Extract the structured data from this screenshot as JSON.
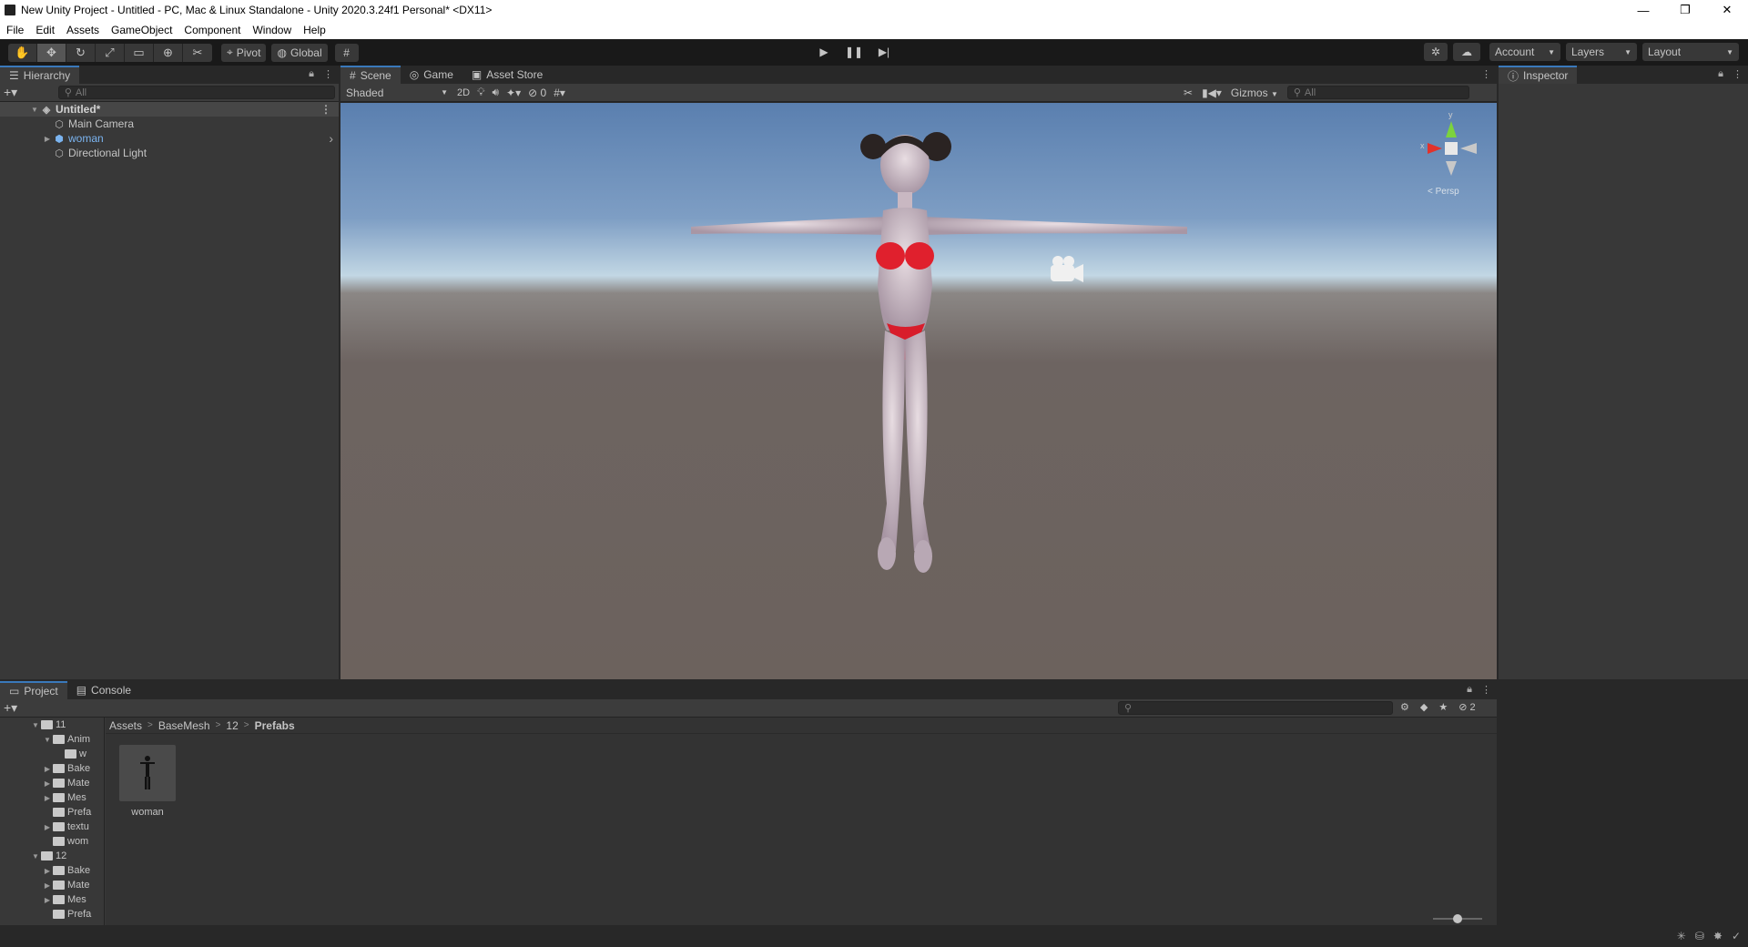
{
  "window": {
    "title": "New Unity Project - Untitled - PC, Mac & Linux Standalone - Unity 2020.3.24f1 Personal* <DX11>",
    "controls": {
      "minimize": "—",
      "restore": "❐",
      "close": "✕"
    }
  },
  "menu": [
    "File",
    "Edit",
    "Assets",
    "GameObject",
    "Component",
    "Window",
    "Help"
  ],
  "toolbar": {
    "tools": [
      {
        "name": "hand-tool",
        "icon": "✋",
        "active": false
      },
      {
        "name": "move-tool",
        "icon": "✥",
        "active": true
      },
      {
        "name": "rotate-tool",
        "icon": "↻",
        "active": false
      },
      {
        "name": "scale-tool",
        "icon": "⤢",
        "active": false
      },
      {
        "name": "rect-tool",
        "icon": "▭",
        "active": false
      },
      {
        "name": "transform-tool",
        "icon": "⊕",
        "active": false
      },
      {
        "name": "custom-tool",
        "icon": "✂",
        "active": false
      }
    ],
    "pivot": "Pivot",
    "global": "Global",
    "account": "Account",
    "layers": "Layers",
    "layout": "Layout"
  },
  "hierarchy": {
    "tab": "Hierarchy",
    "search_placeholder": "All",
    "scene": "Untitled*",
    "items": [
      {
        "label": "Main Camera",
        "prefab": false,
        "expandable": false
      },
      {
        "label": "woman",
        "prefab": true,
        "expandable": true
      },
      {
        "label": "Directional Light",
        "prefab": false,
        "expandable": false
      }
    ]
  },
  "scene": {
    "tabs": [
      "Scene",
      "Game",
      "Asset Store"
    ],
    "shading": "Shaded",
    "mode_2d": "2D",
    "hidden_count": "0",
    "gizmos": "Gizmos",
    "search_placeholder": "All",
    "gizmo_axes": {
      "x": "x",
      "y": "y"
    },
    "persp_label": "< Persp"
  },
  "inspector": {
    "tab": "Inspector"
  },
  "project": {
    "tabs": [
      "Project",
      "Console"
    ],
    "hidden_count": "2",
    "breadcrumb": [
      "Assets",
      "BaseMesh",
      "12",
      "Prefabs"
    ],
    "tree": [
      {
        "label": "11",
        "indent": 1,
        "fold": "▼"
      },
      {
        "label": "Anim",
        "indent": 2,
        "fold": "▼"
      },
      {
        "label": "w",
        "indent": 3,
        "fold": ""
      },
      {
        "label": "Bake",
        "indent": 2,
        "fold": "▶"
      },
      {
        "label": "Mate",
        "indent": 2,
        "fold": "▶"
      },
      {
        "label": "Mes",
        "indent": 2,
        "fold": "▶"
      },
      {
        "label": "Prefa",
        "indent": 2,
        "fold": ""
      },
      {
        "label": "textu",
        "indent": 2,
        "fold": "▶"
      },
      {
        "label": "wom",
        "indent": 2,
        "fold": ""
      },
      {
        "label": "12",
        "indent": 1,
        "fold": "▼"
      },
      {
        "label": "Bake",
        "indent": 2,
        "fold": "▶"
      },
      {
        "label": "Mate",
        "indent": 2,
        "fold": "▶"
      },
      {
        "label": "Mes",
        "indent": 2,
        "fold": "▶"
      },
      {
        "label": "Prefa",
        "indent": 2,
        "fold": ""
      }
    ],
    "assets": [
      {
        "label": "woman"
      }
    ],
    "zoom": 0.5
  }
}
